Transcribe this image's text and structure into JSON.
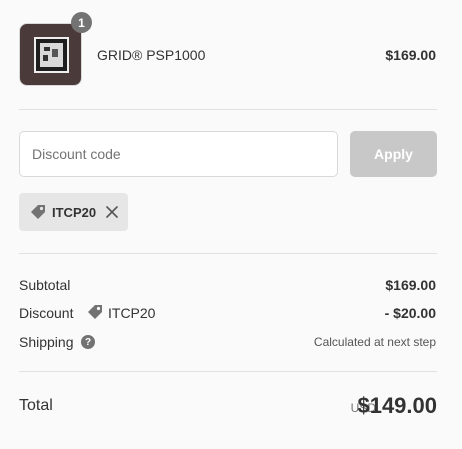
{
  "line_item": {
    "name": "GRID® PSP1000",
    "price": "$169.00",
    "quantity": "1"
  },
  "discount_form": {
    "placeholder": "Discount code",
    "value": "",
    "apply_label": "Apply"
  },
  "applied_discount": {
    "code": "ITCP20"
  },
  "summary": {
    "subtotal_label": "Subtotal",
    "subtotal_value": "$169.00",
    "discount_label": "Discount",
    "discount_code": "ITCP20",
    "discount_value": "- $20.00",
    "shipping_label": "Shipping",
    "shipping_help": "?",
    "shipping_value": "Calculated at next step"
  },
  "total": {
    "label": "Total",
    "currency": "USD",
    "amount": "$149.00"
  },
  "colors": {
    "background": "#fafafa",
    "apply_button_disabled": "#c8c8c8",
    "badge": "#737373",
    "tag_background": "#e6e6e6",
    "divider": "#e1e1e1"
  },
  "icons": {
    "tag": "tag-icon",
    "remove": "close-icon",
    "help": "question-circle-icon"
  }
}
